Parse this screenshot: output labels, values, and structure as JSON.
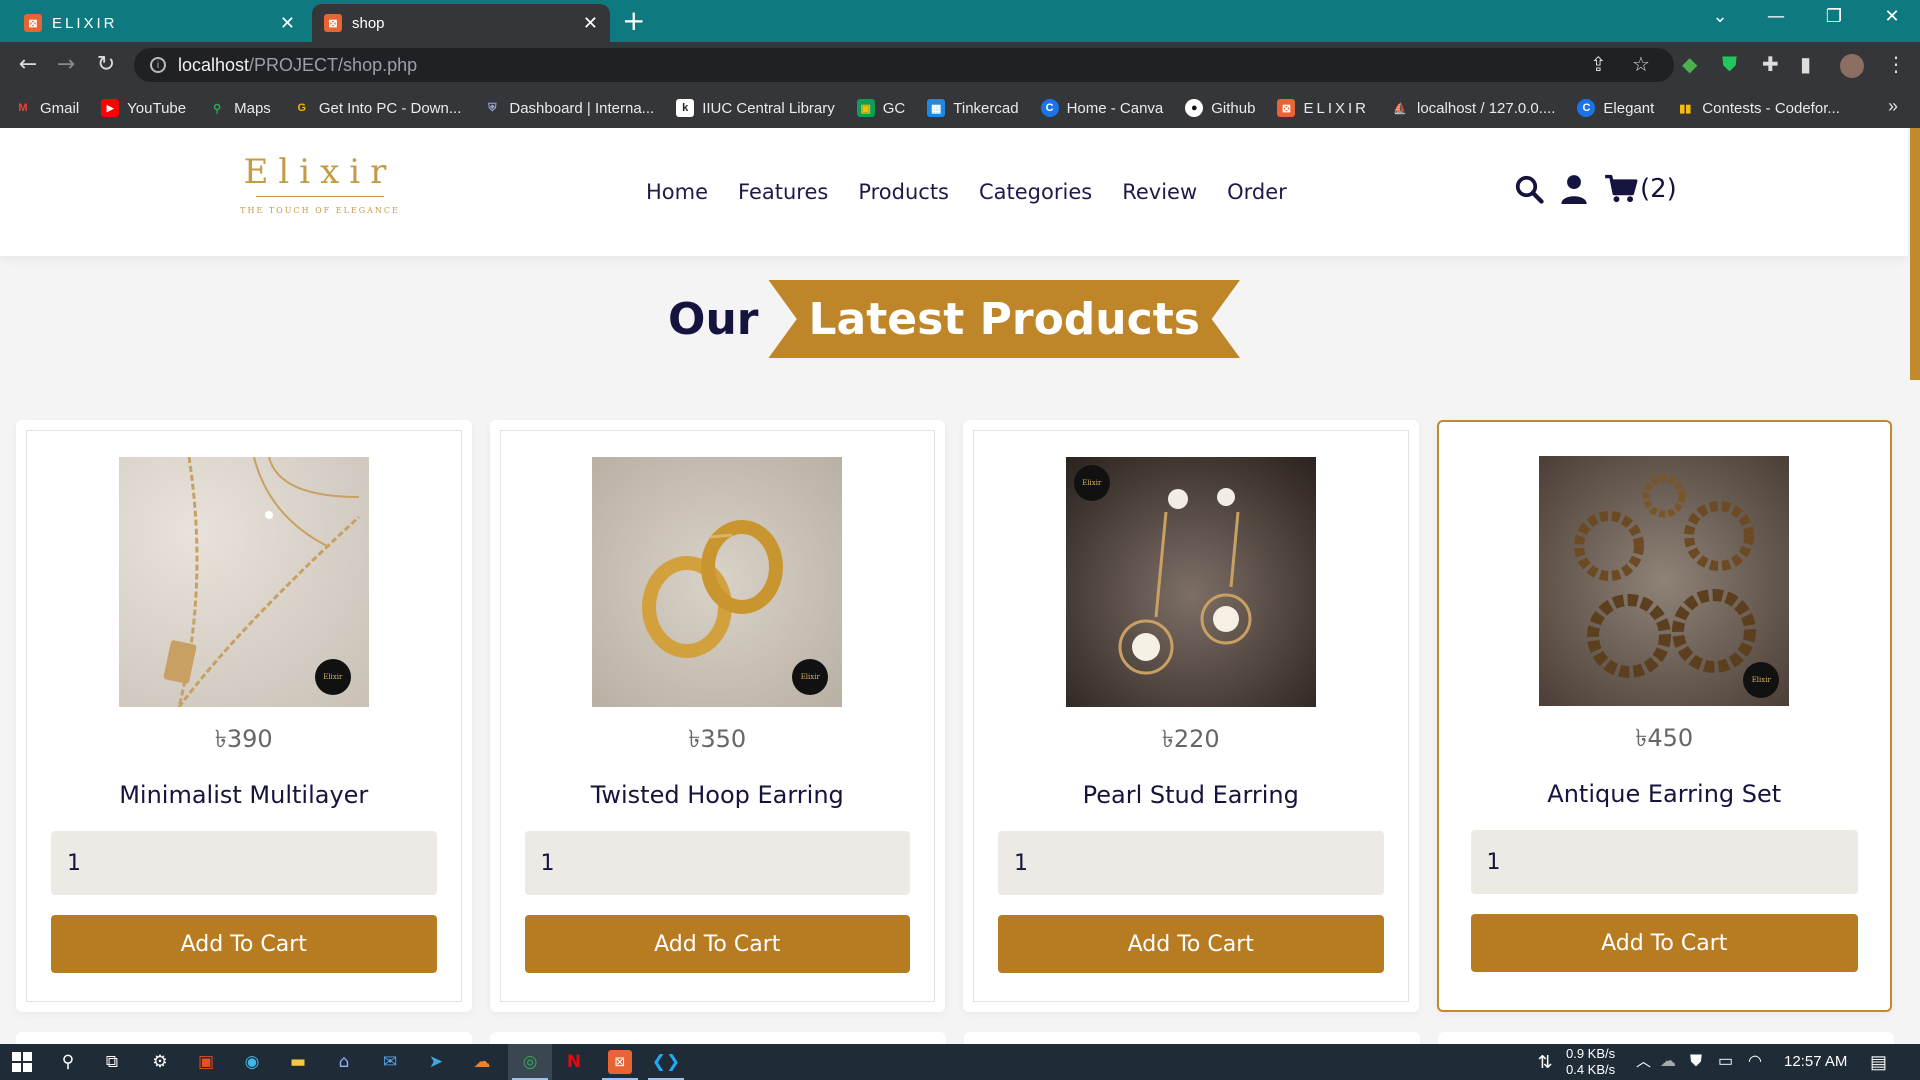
{
  "browser": {
    "tabs": [
      {
        "favicon": "xampp-icon",
        "title": "ELIXIR"
      },
      {
        "favicon": "xampp-icon",
        "title": "shop"
      }
    ],
    "url_host": "localhost",
    "url_path": "/PROJECT/shop.php",
    "bookmarks": [
      {
        "label": "Gmail",
        "icon": "gmail-icon",
        "color": "#ea4335"
      },
      {
        "label": "YouTube",
        "icon": "youtube-icon",
        "color": "#ff0000"
      },
      {
        "label": "Maps",
        "icon": "maps-icon",
        "color": "#34a853"
      },
      {
        "label": "Get Into PC - Down...",
        "icon": "getintopc-icon",
        "color": "#f4b400"
      },
      {
        "label": "Dashboard | Interna...",
        "icon": "iiuc-icon",
        "color": "#3f51b5"
      },
      {
        "label": "IIUC Central Library",
        "icon": "library-icon",
        "color": "#ffffff"
      },
      {
        "label": "GC",
        "icon": "classroom-icon",
        "color": "#0f9d58"
      },
      {
        "label": "Tinkercad",
        "icon": "tinkercad-icon",
        "color": "#e44d26"
      },
      {
        "label": "Home - Canva",
        "icon": "canva-icon",
        "color": "#00c4cc"
      },
      {
        "label": "Github",
        "icon": "github-icon",
        "color": "#ffffff"
      },
      {
        "label": "ELIXIR",
        "icon": "xampp-icon",
        "color": "#e86433"
      },
      {
        "label": "localhost / 127.0.0....",
        "icon": "phpmyadmin-icon",
        "color": "#f29111"
      },
      {
        "label": "Elegant",
        "icon": "elegant-icon",
        "color": "#1a73e8"
      },
      {
        "label": "Contests - Codefor...",
        "icon": "codeforces-icon",
        "color": "#1f8acb"
      }
    ]
  },
  "site": {
    "logo_word": "Elixir",
    "logo_tagline": "THE TOUCH OF ELEGANCE",
    "nav": [
      "Home",
      "Features",
      "Products",
      "Categories",
      "Review",
      "Order"
    ],
    "cart_count": "(2)",
    "heading_plain": "Our",
    "heading_ribbon": "Latest Products",
    "accent_color": "#bf8529",
    "navy_color": "#15143e"
  },
  "products": [
    {
      "price": "৳390",
      "name": "Minimalist Multilayer",
      "qty": "1",
      "button": "Add To Cart",
      "image": "gold-necklace-photo"
    },
    {
      "price": "৳350",
      "name": "Twisted Hoop Earring",
      "qty": "1",
      "button": "Add To Cart",
      "image": "gold-hoop-earring-photo"
    },
    {
      "price": "৳220",
      "name": "Pearl Stud Earring",
      "qty": "1",
      "button": "Add To Cart",
      "image": "pearl-earring-photo"
    },
    {
      "price": "৳450",
      "name": "Antique Earring Set",
      "qty": "1",
      "button": "Add To Cart",
      "image": "antique-earring-photo"
    }
  ],
  "taskbar": {
    "net_down": "0.9 KB/s",
    "net_up": "0.4 KB/s",
    "time": "12:57 AM"
  }
}
